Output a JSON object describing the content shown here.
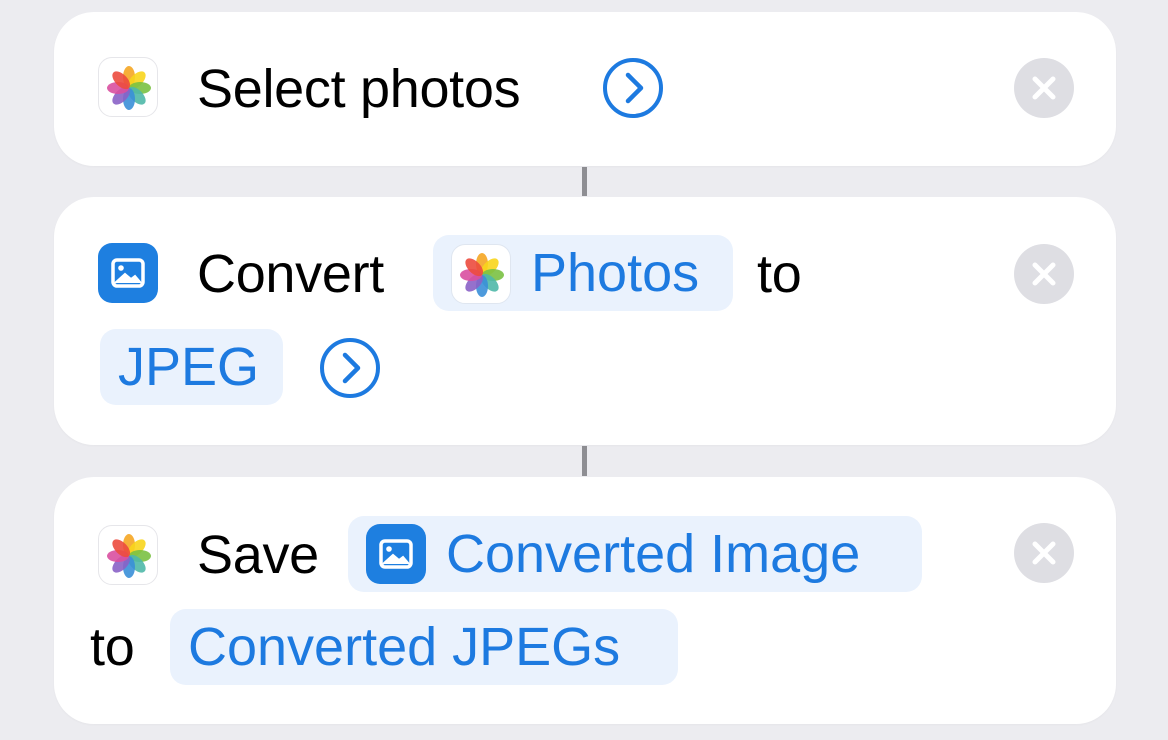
{
  "actions": [
    {
      "app_icon": "photos-app-icon",
      "label": "Select photos",
      "expand_icon": "chevron-right-circle-icon",
      "remove_icon": "close-icon"
    },
    {
      "app_icon": "image-icon",
      "verb": "Convert",
      "input_token": {
        "icon": "photos-app-icon",
        "label": "Photos"
      },
      "connector": "to",
      "format_token": "JPEG",
      "expand_icon": "chevron-right-circle-icon",
      "remove_icon": "close-icon"
    },
    {
      "app_icon": "photos-app-icon",
      "verb": "Save",
      "input_token": {
        "icon": "image-icon",
        "label": "Converted Image"
      },
      "connector": "to",
      "album_token": "Converted JPEGs",
      "remove_icon": "close-icon"
    }
  ],
  "colors": {
    "background": "#ececf0",
    "card": "#ffffff",
    "accent": "#1d7ae0",
    "token_bg": "#eaf2fd",
    "close_bg": "#dedee3",
    "connector": "#8e8e93"
  }
}
